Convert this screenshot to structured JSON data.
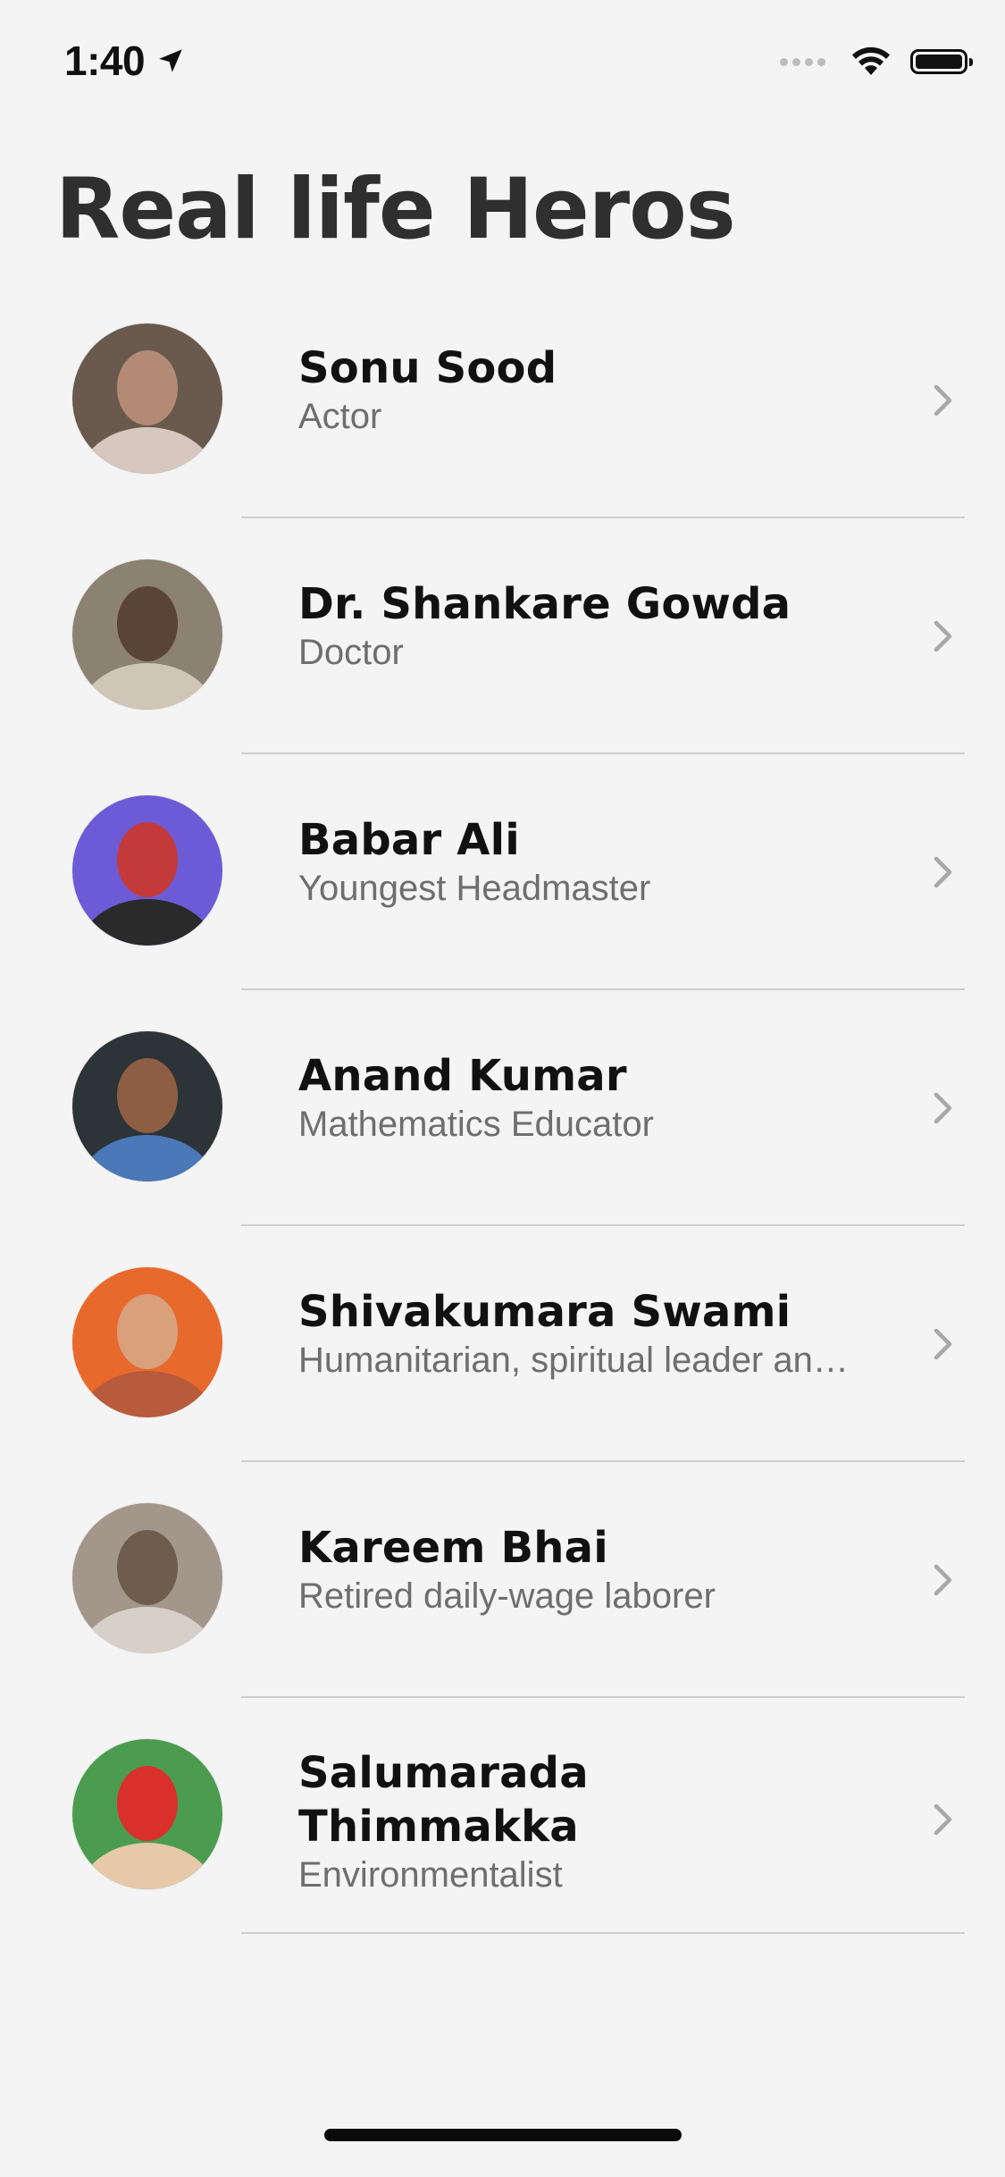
{
  "status_bar": {
    "time": "1:40",
    "icons": [
      "location-arrow-icon",
      "signal-icon",
      "wifi-icon",
      "battery-icon"
    ]
  },
  "page": {
    "title": "Real life Heros"
  },
  "heroes": [
    {
      "name": "Sonu Sood",
      "role": "Actor",
      "avatar_colors": [
        "#6a5a4e",
        "#b38b74",
        "#d6c7bf"
      ]
    },
    {
      "name": "Dr. Shankare Gowda",
      "role": "Doctor",
      "avatar_colors": [
        "#8c8272",
        "#5a4436",
        "#cfc6b6"
      ]
    },
    {
      "name": "Babar Ali",
      "role": "Youngest Headmaster",
      "avatar_colors": [
        "#6d5ad6",
        "#c43a3a",
        "#2a2a2a"
      ]
    },
    {
      "name": "Anand Kumar",
      "role": "Mathematics Educator",
      "avatar_colors": [
        "#2d3438",
        "#8d5e43",
        "#4a78b8"
      ]
    },
    {
      "name": "Shivakumara Swami",
      "role": "Humanitarian, spiritual leader and educator",
      "avatar_colors": [
        "#e8692c",
        "#d9a07c",
        "#b85a3c"
      ]
    },
    {
      "name": "Kareem Bhai",
      "role": "Retired daily-wage laborer",
      "avatar_colors": [
        "#a3968a",
        "#6e5c4c",
        "#d7d0c8"
      ]
    },
    {
      "name": "Salumarada Thimmakka",
      "role": "Environmentalist",
      "avatar_colors": [
        "#4b9c4e",
        "#d9302c",
        "#e7c8a8"
      ]
    }
  ],
  "colors": {
    "background": "#f4f4f4",
    "title": "#2f2f2f",
    "subtitle": "#6e6e6e",
    "separator": "#cfcfcf",
    "chevron": "#a8a8a8"
  }
}
